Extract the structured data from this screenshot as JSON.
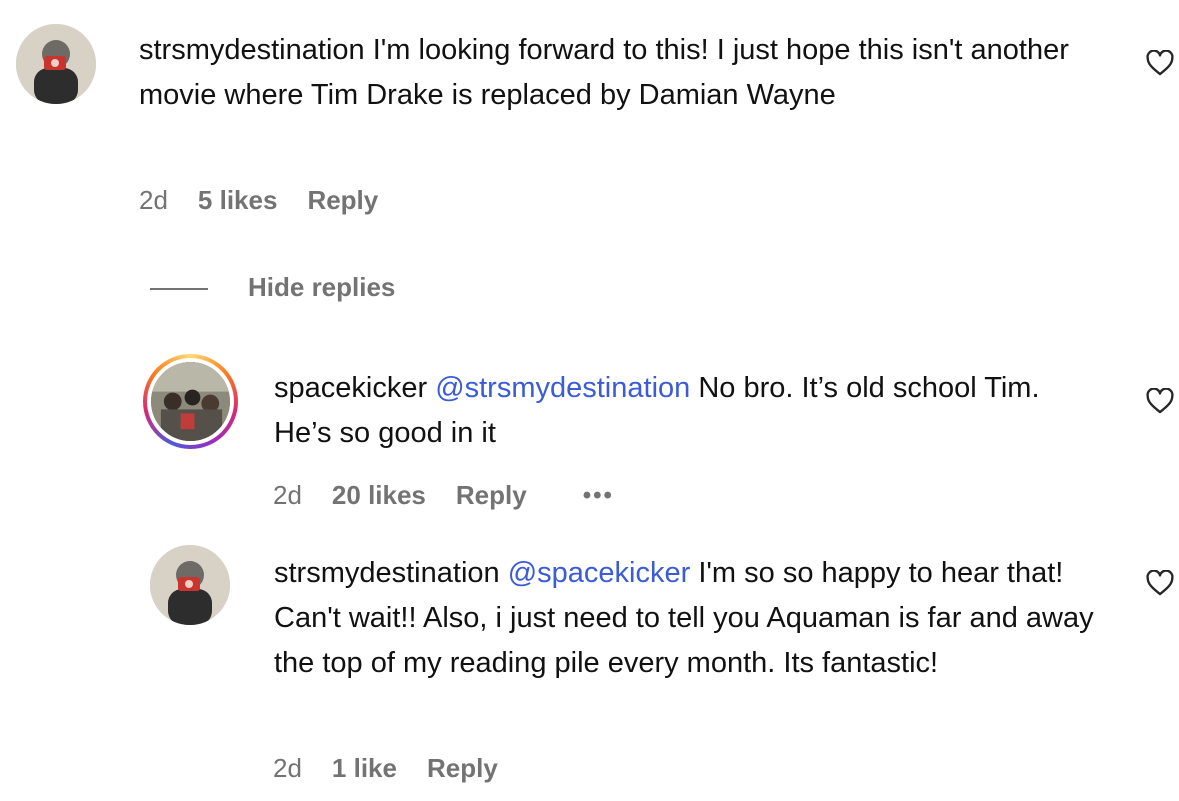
{
  "comments": [
    {
      "username": "strsmydestination",
      "mention": "",
      "text": " I'm looking forward to this! I just hope this isn't another movie where Tim Drake is replaced by Damian Wayne",
      "time": "2d",
      "likes": "5 likes",
      "reply": "Reply"
    },
    {
      "username": "spacekicker",
      "mention": "@strsmydestination",
      "text": " No bro. It’s old school Tim. He’s so good in it",
      "time": "2d",
      "likes": "20 likes",
      "reply": "Reply",
      "more": "•••"
    },
    {
      "username": "strsmydestination",
      "mention": "@spacekicker",
      "text": " I'm so so happy to hear that! Can't wait!! Also, i just need to tell you Aquaman is far and away the top of my reading pile every month. Its fantastic!",
      "time": "2d",
      "likes": "1 like",
      "reply": "Reply"
    }
  ],
  "hide_replies": "Hide replies",
  "icons": {
    "like": "heart-outline-icon",
    "story_ring": "story-ring"
  },
  "colors": {
    "mention": "#3b5bd9",
    "meta": "#737373"
  }
}
